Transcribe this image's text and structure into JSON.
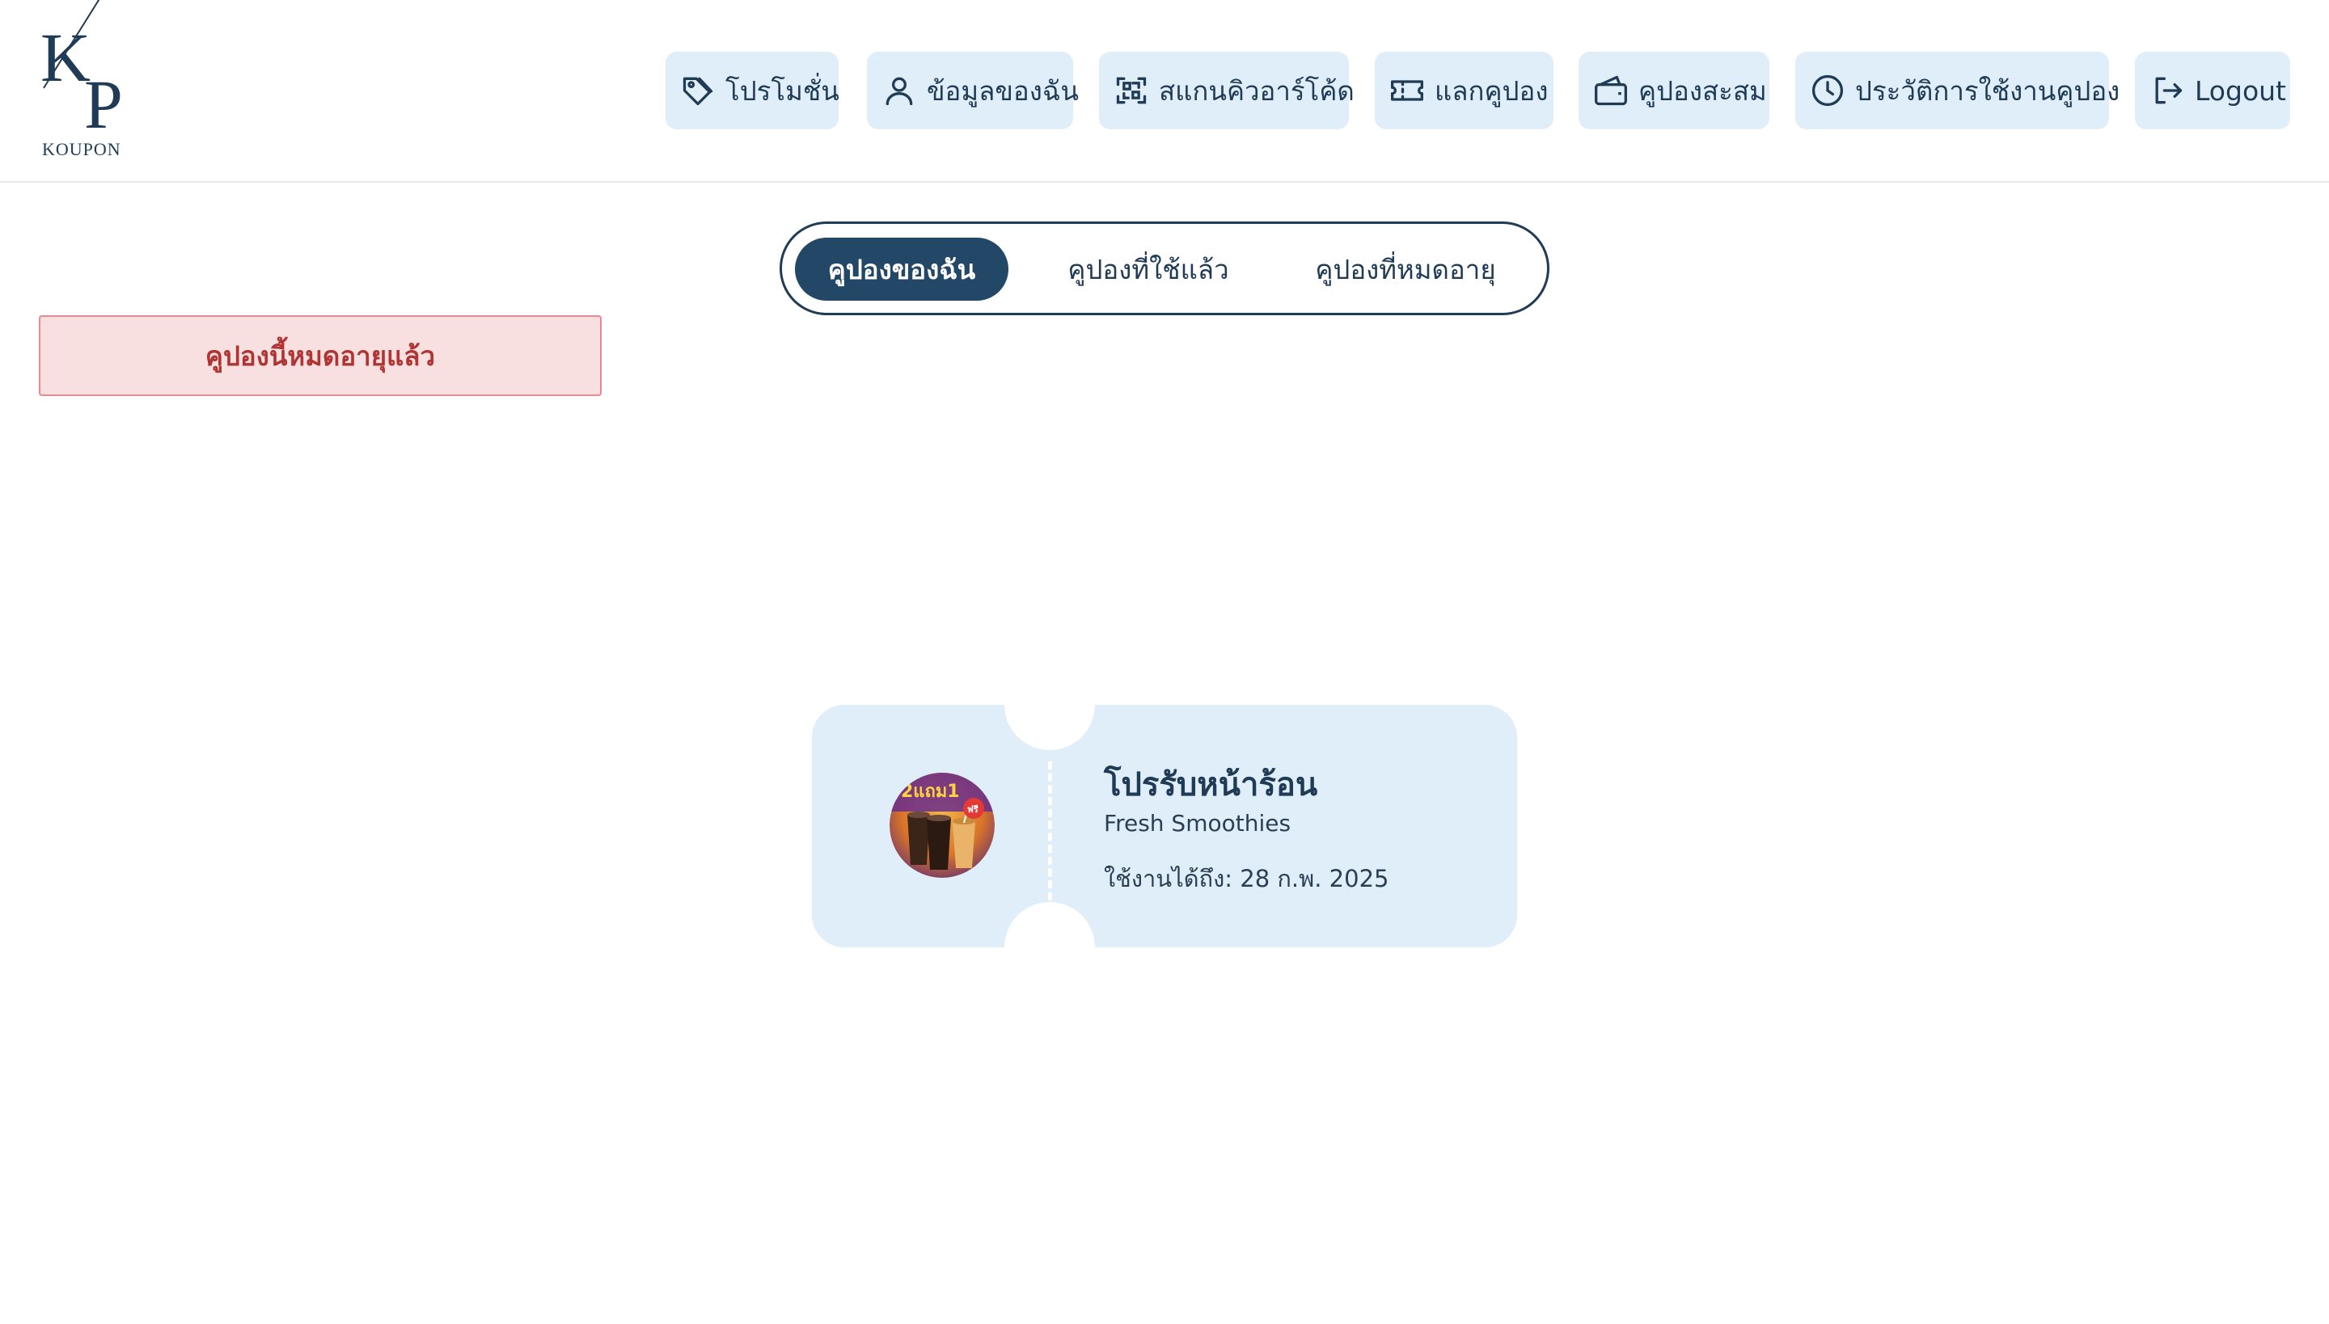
{
  "logo": {
    "letters_top": "K",
    "letters_bottom": "P",
    "word": "KOUPON"
  },
  "nav": {
    "items": [
      {
        "label": "โปรโมชั่น",
        "icon": "tag-icon"
      },
      {
        "label": "ข้อมูลของฉัน",
        "icon": "user-icon"
      },
      {
        "label": "สแกนคิวอาร์โค้ด",
        "icon": "qr-scan-icon"
      },
      {
        "label": "แลกคูปอง",
        "icon": "ticket-icon"
      },
      {
        "label": "คูปองสะสม",
        "icon": "wallet-icon"
      },
      {
        "label": "ประวัติการใช้งานคูปอง",
        "icon": "clock-icon"
      },
      {
        "label": "Logout",
        "icon": "logout-icon"
      }
    ]
  },
  "tabs": [
    {
      "label": "คูปองของฉัน",
      "active": true
    },
    {
      "label": "คูปองที่ใช้แล้ว",
      "active": false
    },
    {
      "label": "คูปองที่หมดอายุ",
      "active": false
    }
  ],
  "alert": {
    "message": "คูปองนี้หมดอายุแล้ว"
  },
  "coupon": {
    "title": "โปรรับหน้าร้อน",
    "store": "Fresh Smoothies",
    "expiry": "ใช้งานได้ถึง: 28 ก.พ. 2025",
    "image_badge": "2แถม1",
    "image_badge_small": "ฟรี"
  },
  "colors": {
    "primary": "#234766",
    "text": "#1f3b55",
    "nav_bg": "#dfeef9",
    "coupon_bg": "#dfeef9",
    "alert_bg": "#f8e0e1",
    "alert_text": "#b03434"
  }
}
